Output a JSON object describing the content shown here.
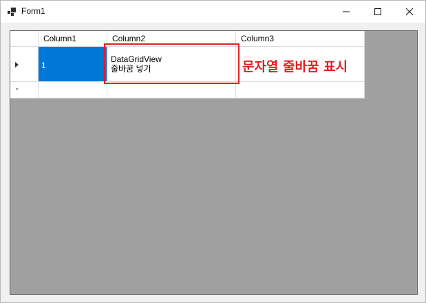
{
  "window": {
    "title": "Form1"
  },
  "grid": {
    "columns": [
      "Column1",
      "Column2",
      "Column3"
    ],
    "rows": [
      {
        "cells": [
          "1",
          "DataGridView\n줄바꿈 넣기",
          ""
        ]
      }
    ],
    "new_row_marker": "*"
  },
  "annotation": {
    "text": "문자열 줄바꿈 표시"
  },
  "colors": {
    "selection": "#0078d7",
    "annotation": "#e02020",
    "background": "#a0a0a0"
  }
}
